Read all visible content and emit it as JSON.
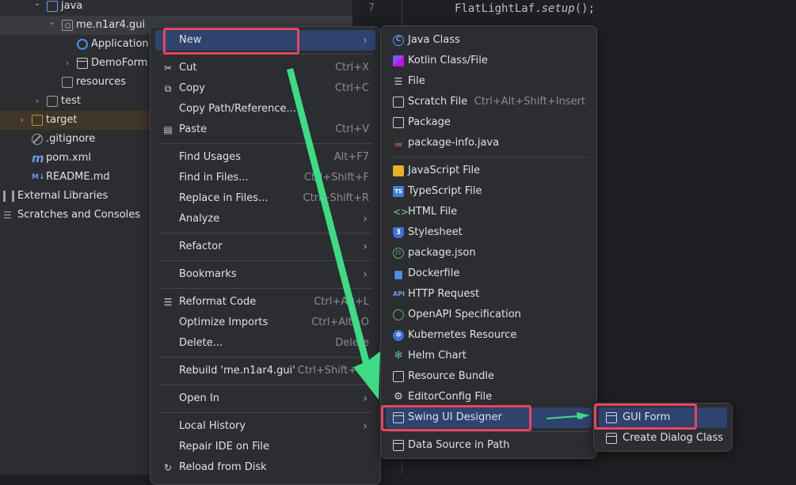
{
  "project_tree": [
    {
      "label": "java",
      "icon": "folder-icon",
      "indent": 1,
      "arrow": "v",
      "state": "normal",
      "icon_color": "blue"
    },
    {
      "label": "me.n1ar4.gui",
      "icon": "package-icon",
      "indent": 2,
      "arrow": "v",
      "state": "selected"
    },
    {
      "label": "Application",
      "icon": "application-icon",
      "indent": 3,
      "arrow": "",
      "state": "normal"
    },
    {
      "label": "DemoForm",
      "icon": "form-icon",
      "indent": 3,
      "arrow": ">",
      "state": "normal"
    },
    {
      "label": "resources",
      "icon": "folder-icon",
      "indent": 2,
      "arrow": "",
      "state": "normal"
    },
    {
      "label": "test",
      "icon": "folder-icon",
      "indent": 1,
      "arrow": ">",
      "state": "normal"
    },
    {
      "label": "target",
      "icon": "folder-icon",
      "indent": 0,
      "arrow": ">",
      "state": "highlight",
      "icon_color": "orange"
    },
    {
      "label": ".gitignore",
      "icon": "gitignore-icon",
      "indent": 0,
      "arrow": "",
      "state": "normal"
    },
    {
      "label": "pom.xml",
      "icon": "maven-icon",
      "indent": 0,
      "arrow": "",
      "state": "normal"
    },
    {
      "label": "README.md",
      "icon": "markdown-icon",
      "indent": 0,
      "arrow": "",
      "state": "normal"
    },
    {
      "label": "External Libraries",
      "icon": "libraries-icon",
      "indent": -1,
      "arrow": ">",
      "state": "normal"
    },
    {
      "label": "Scratches and Consoles",
      "icon": "scratches-icon",
      "indent": -1,
      "arrow": ">",
      "state": "normal"
    }
  ],
  "editor": {
    "line_number": "7",
    "code_prefix": "FlatLightLaf.",
    "code_method": "setup",
    "code_suffix": "();"
  },
  "context_menu": [
    {
      "type": "item",
      "label": "New",
      "shortcut": "",
      "submenu": true,
      "icon": "",
      "active": true
    },
    {
      "type": "sep"
    },
    {
      "type": "item",
      "label": "Cut",
      "shortcut": "Ctrl+X",
      "icon": "scissors-icon"
    },
    {
      "type": "item",
      "label": "Copy",
      "shortcut": "Ctrl+C",
      "icon": "copy-icon"
    },
    {
      "type": "item",
      "label": "Copy Path/Reference...",
      "shortcut": ""
    },
    {
      "type": "item",
      "label": "Paste",
      "shortcut": "Ctrl+V",
      "icon": "paste-icon"
    },
    {
      "type": "sep"
    },
    {
      "type": "item",
      "label": "Find Usages",
      "shortcut": "Alt+F7"
    },
    {
      "type": "item",
      "label": "Find in Files...",
      "shortcut": "Ctrl+Shift+F"
    },
    {
      "type": "item",
      "label": "Replace in Files...",
      "shortcut": "Ctrl+Shift+R"
    },
    {
      "type": "item",
      "label": "Analyze",
      "submenu": true
    },
    {
      "type": "sep"
    },
    {
      "type": "item",
      "label": "Refactor",
      "submenu": true
    },
    {
      "type": "sep"
    },
    {
      "type": "item",
      "label": "Bookmarks",
      "submenu": true
    },
    {
      "type": "sep"
    },
    {
      "type": "item",
      "label": "Reformat Code",
      "shortcut": "Ctrl+Alt+L",
      "icon": "reformat-icon"
    },
    {
      "type": "item",
      "label": "Optimize Imports",
      "shortcut": "Ctrl+Alt+O"
    },
    {
      "type": "item",
      "label": "Delete...",
      "shortcut": "Delete"
    },
    {
      "type": "sep"
    },
    {
      "type": "item",
      "label": "Rebuild 'me.n1ar4.gui'",
      "shortcut": "Ctrl+Shift+F9"
    },
    {
      "type": "sep"
    },
    {
      "type": "item",
      "label": "Open In",
      "submenu": true
    },
    {
      "type": "sep"
    },
    {
      "type": "item",
      "label": "Local History",
      "submenu": true
    },
    {
      "type": "item",
      "label": "Repair IDE on File"
    },
    {
      "type": "item",
      "label": "Reload from Disk",
      "icon": "reload-icon"
    }
  ],
  "new_menu": [
    {
      "type": "item",
      "label": "Java Class",
      "icon": "java-class-icon",
      "cls": "ic-c",
      "glyph": "C"
    },
    {
      "type": "item",
      "label": "Kotlin Class/File",
      "icon": "kotlin-icon",
      "cls": "ic-k",
      "glyph": ""
    },
    {
      "type": "item",
      "label": "File",
      "icon": "file-icon",
      "cls": "",
      "glyph": "☰"
    },
    {
      "type": "item",
      "label": "Scratch File",
      "shortcut": "Ctrl+Alt+Shift+Insert",
      "icon": "scratch-file-icon",
      "cls": "ic-file",
      "glyph": ""
    },
    {
      "type": "item",
      "label": "Package",
      "icon": "package-icon",
      "cls": "ic-pkg",
      "glyph": ""
    },
    {
      "type": "item",
      "label": "package-info.java",
      "icon": "java-cup-icon",
      "cls": "ic-cup",
      "glyph": "☕"
    },
    {
      "type": "sep"
    },
    {
      "type": "item",
      "label": "JavaScript File",
      "icon": "javascript-icon",
      "cls": "ic-js",
      "glyph": ""
    },
    {
      "type": "item",
      "label": "TypeScript File",
      "icon": "typescript-icon",
      "cls": "ic-ts",
      "glyph": "TS"
    },
    {
      "type": "item",
      "label": "HTML File",
      "icon": "html-icon",
      "cls": "ic-html",
      "glyph": "<>"
    },
    {
      "type": "item",
      "label": "Stylesheet",
      "icon": "css-icon",
      "cls": "ic-css",
      "glyph": "3"
    },
    {
      "type": "item",
      "label": "package.json",
      "icon": "npm-icon",
      "cls": "ic-npm",
      "glyph": "JS"
    },
    {
      "type": "item",
      "label": "Dockerfile",
      "icon": "docker-icon",
      "cls": "ic-dock",
      "glyph": "▆"
    },
    {
      "type": "item",
      "label": "HTTP Request",
      "icon": "api-icon",
      "cls": "ic-api",
      "glyph": "API"
    },
    {
      "type": "item",
      "label": "OpenAPI Specification",
      "icon": "openapi-icon",
      "cls": "ic-oapi",
      "glyph": ""
    },
    {
      "type": "item",
      "label": "Kubernetes Resource",
      "icon": "kubernetes-icon",
      "cls": "ic-k8s",
      "glyph": "✲"
    },
    {
      "type": "item",
      "label": "Helm Chart",
      "icon": "helm-icon",
      "cls": "ic-helm",
      "glyph": "✻"
    },
    {
      "type": "item",
      "label": "Resource Bundle",
      "icon": "bundle-icon",
      "cls": "ic-bundle",
      "glyph": ""
    },
    {
      "type": "item",
      "label": "EditorConfig File",
      "icon": "gear-icon",
      "cls": "ic-gear",
      "glyph": "⚙"
    },
    {
      "type": "item",
      "label": "Swing UI Designer",
      "icon": "window-icon",
      "cls": "ic-win",
      "glyph": "",
      "submenu": true,
      "active": true
    },
    {
      "type": "sep"
    },
    {
      "type": "item",
      "label": "Data Source in Path",
      "icon": "datasource-icon",
      "cls": "ic-db",
      "glyph": ""
    }
  ],
  "swing_menu": [
    {
      "label": "GUI Form",
      "icon": "window-icon",
      "active": true
    },
    {
      "label": "Create Dialog Class",
      "icon": "window-icon",
      "active": false
    }
  ],
  "colors": {
    "selection": "#2e436e",
    "annotation_red": "#e8445f",
    "annotation_green": "#3ddc84"
  }
}
